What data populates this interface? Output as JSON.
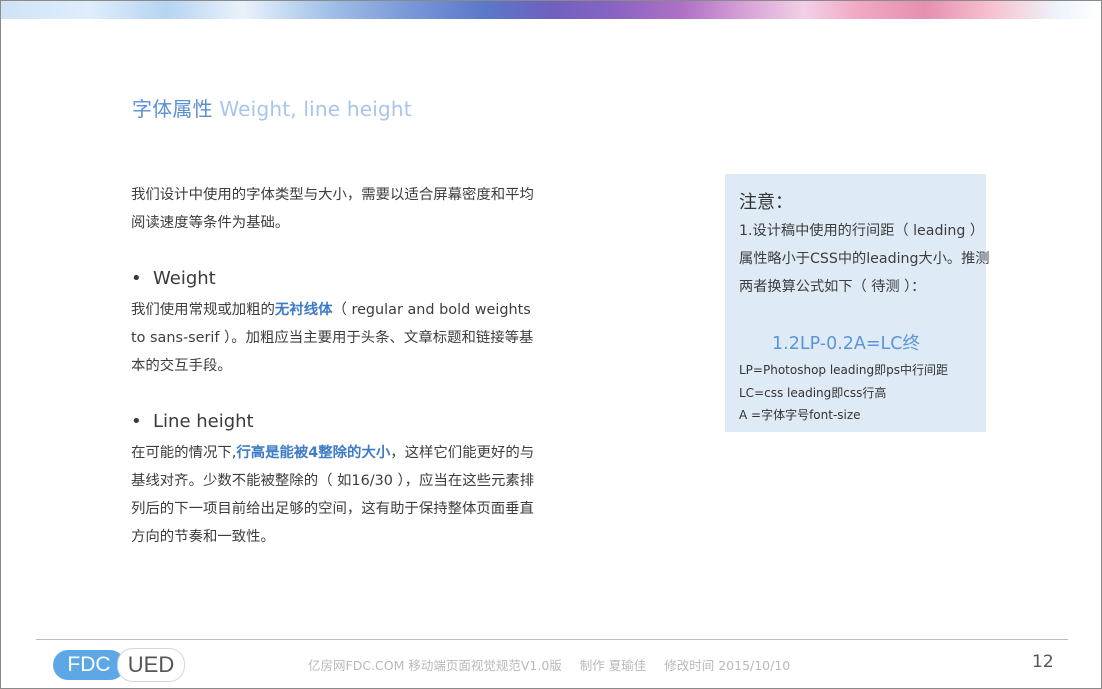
{
  "slide": {
    "title_zh": "字体属性",
    "title_en": "Weight, line height",
    "intro": "我们设计中使用的字体类型与大小，需要以适合屏幕密度和平均阅读速度等条件为基础。",
    "weight": {
      "bullet": "•",
      "heading": "Weight",
      "text_before": "我们使用常规或加粗的",
      "highlight": "无衬线体",
      "text_after": "（ regular and bold weights to sans-serif ）。加粗应当主要用于头条、文章标题和链接等基本的交互手段。"
    },
    "line_height": {
      "bullet": "•",
      "heading": "Line height",
      "text_before": "在可能的情况下,",
      "highlight": "行高是能被4整除的大小",
      "text_after": "，这样它们能更好的与基线对齐。少数不能被整除的（ 如16/30 ），应当在这些元素排列后的下一项目前给出足够的空间，这有助于保持整体页面垂直方向的节奏和一致性。"
    }
  },
  "note": {
    "title": "注意：",
    "body": "1.设计稿中使用的行间距（ leading ）属性略小于CSS中的leading大小。推测两者换算公式如下（ 待测 ）：",
    "formula": "1.2LP-0.2A=LC终",
    "def_lp": "LP=Photoshop leading即ps中行间距",
    "def_lc": "LC=css leading即css行高",
    "def_a": "A =字体字号font-size"
  },
  "footer": {
    "logo_left": "FDC",
    "logo_right": "UED",
    "doc": "亿房网FDC.COM 移动端页面视觉规范V1.0版",
    "author": "制作 夏瑜佳",
    "modified": "修改时间  2015/10/10",
    "page_number": "12"
  },
  "colors": {
    "accent": "#5a8fd0",
    "accent_light": "#a8c5ea",
    "highlight": "#3e7cc6",
    "note_bg": "#dfeaf7"
  }
}
